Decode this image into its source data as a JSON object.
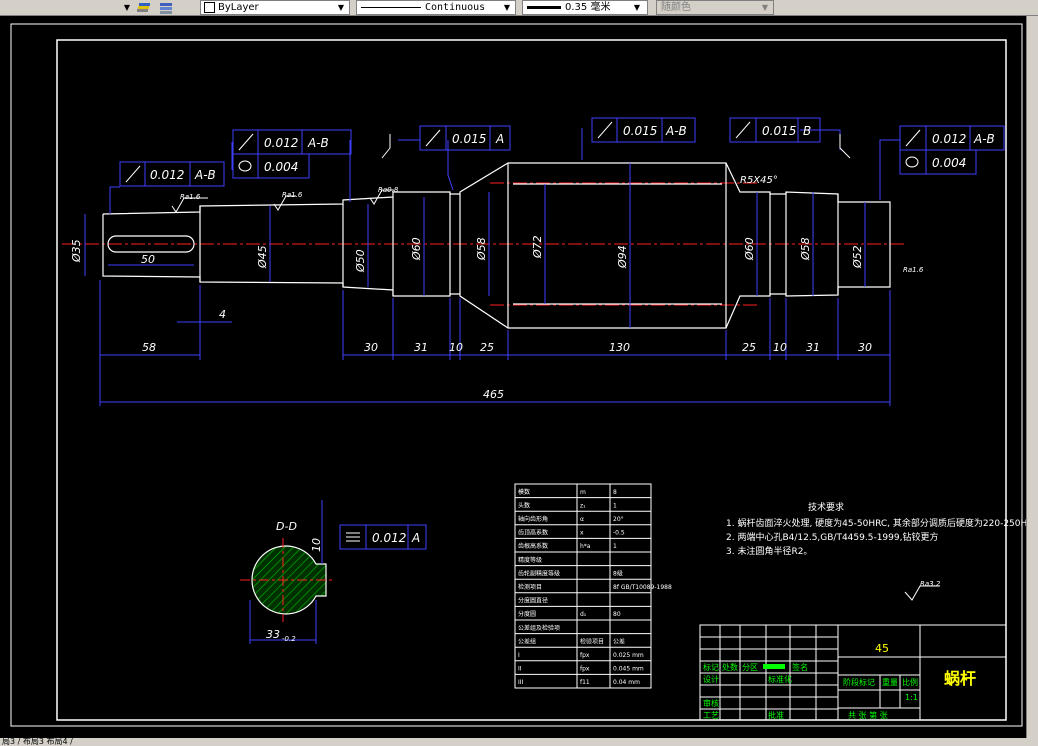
{
  "toolbar": {
    "color_value": "ByLayer",
    "linetype_value": "Continuous",
    "lineweight_value": "0.35 毫米",
    "plotstyle_value": "随颜色"
  },
  "drawing": {
    "datum_a": "A",
    "datum_b": "B",
    "datum_ab": "A-B",
    "tol_0012": "0.012",
    "tol_0015": "0.015",
    "tol_0004": "0.004",
    "tol_0012_plain": "0.012",
    "dim_50": "50",
    "dim_58": "58",
    "dim_4": "4",
    "dim_30a": "30",
    "dim_31a": "31",
    "dim_10a": "10",
    "dim_25a": "25",
    "dim_130": "130",
    "dim_25b": "25",
    "dim_10b": "10",
    "dim_31b": "31",
    "dim_30b": "30",
    "dim_465": "465",
    "dim_d35": "Ø35",
    "dim_d45": "Ø45",
    "dim_d50": "Ø50",
    "dim_d60a": "Ø60",
    "dim_d58a": "Ø58",
    "dim_d72": "Ø72",
    "dim_d94": "Ø94",
    "dim_d58b": "Ø58",
    "dim_d60b": "Ø60",
    "dim_d52": "Ø52",
    "chamfer": "R5X45°",
    "ra08": "Ra0.8",
    "ra16": "Ra1.6",
    "ra32": "Ra3.2",
    "section_label": "D-D",
    "section_dim": "33",
    "section_dim_tol": "-0.2",
    "section_side": "10",
    "tech_title": "技术要求",
    "tech_1": "1. 蜗杆齿面淬火处理, 硬度为45-50HRC, 其余部分调质后硬度为220-250HBS。",
    "tech_2": "2. 两端中心孔B4/12.5,GB/T4459.5-1999,钻铰更方",
    "tech_3": "3. 未注圆角半径R2。"
  },
  "param_table": {
    "rows": [
      [
        "模数",
        "m",
        "8"
      ],
      [
        "头数",
        "z₁",
        "1"
      ],
      [
        "轴向齿形角",
        "α",
        "20°"
      ],
      [
        "齿顶高系数",
        "x",
        "-0.5"
      ],
      [
        "齿根高系数",
        "h*a",
        "1"
      ],
      [
        "精度等级",
        "",
        ""
      ],
      [
        "齿轮副精度等级",
        "",
        "8级"
      ],
      [
        "检测项目",
        "",
        "8f GB/T10089-1988"
      ],
      [
        "分度圆直径",
        "",
        ""
      ],
      [
        "分度圆",
        "d₁",
        "80"
      ],
      [
        "公差组及检验项",
        "",
        ""
      ],
      [
        "公差组",
        "检验项目",
        "公差"
      ],
      [
        "I",
        "fpx",
        "0.025 mm"
      ],
      [
        "II",
        "fpx",
        "0.045 mm"
      ],
      [
        "III",
        "f11",
        "0.04 mm"
      ]
    ]
  },
  "title_block": {
    "material": "45",
    "part_name": "蜗杆",
    "scale": "1:1",
    "scale_label": "比例",
    "weight_label": "重量",
    "stage_label": "阶段标记",
    "sheet_label": "共 张 第 张",
    "designer_label": "设计",
    "standard_label": "标准化",
    "checker_label": "审核",
    "process_label": "工艺",
    "approver_label": "批准",
    "mark_label": "标记",
    "count_label": "处数",
    "zone_label": "分区",
    "sign_label": "签名"
  },
  "status": {
    "tabs": "局3 / 布局3 布局4 /"
  }
}
